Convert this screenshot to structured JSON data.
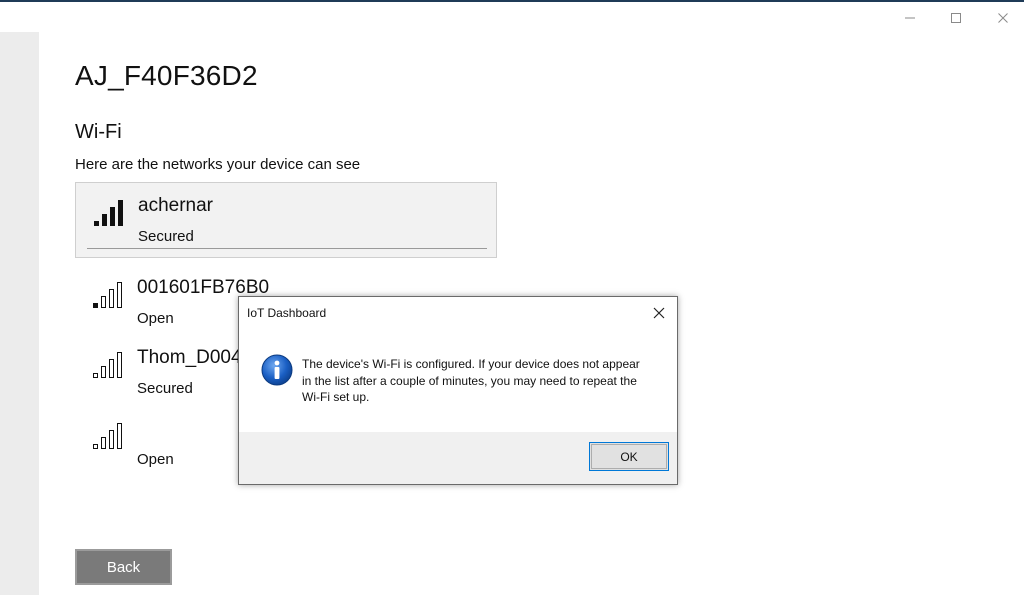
{
  "window": {
    "controls": {
      "minimize_icon": "minimize-icon",
      "maximize_icon": "maximize-icon",
      "close_icon": "close-icon"
    }
  },
  "page": {
    "title": "AJ_F40F36D2",
    "section": "Wi-Fi",
    "subtitle": "Here are the networks your device can see"
  },
  "networks": [
    {
      "name": "achernar",
      "status": "Secured",
      "bars": 4,
      "selected": true
    },
    {
      "name": "001601FB76B0",
      "status": "Open",
      "bars": 1,
      "selected": false
    },
    {
      "name": "Thom_D004",
      "status": "Secured",
      "bars": 1,
      "selected": false
    },
    {
      "name": "",
      "status": "Open",
      "bars": 1,
      "selected": false
    }
  ],
  "back_button": {
    "label": "Back"
  },
  "dialog": {
    "title": "IoT Dashboard",
    "message": "The device's Wi-Fi is configured.  If your device does not appear in the list after a couple of minutes, you may need to repeat the Wi-Fi set up.",
    "ok_label": "OK",
    "icon": "info-icon"
  },
  "colors": {
    "accent": "#0078d7",
    "back_button": "#7a7a7a",
    "info_icon": "#1a5fc4"
  }
}
